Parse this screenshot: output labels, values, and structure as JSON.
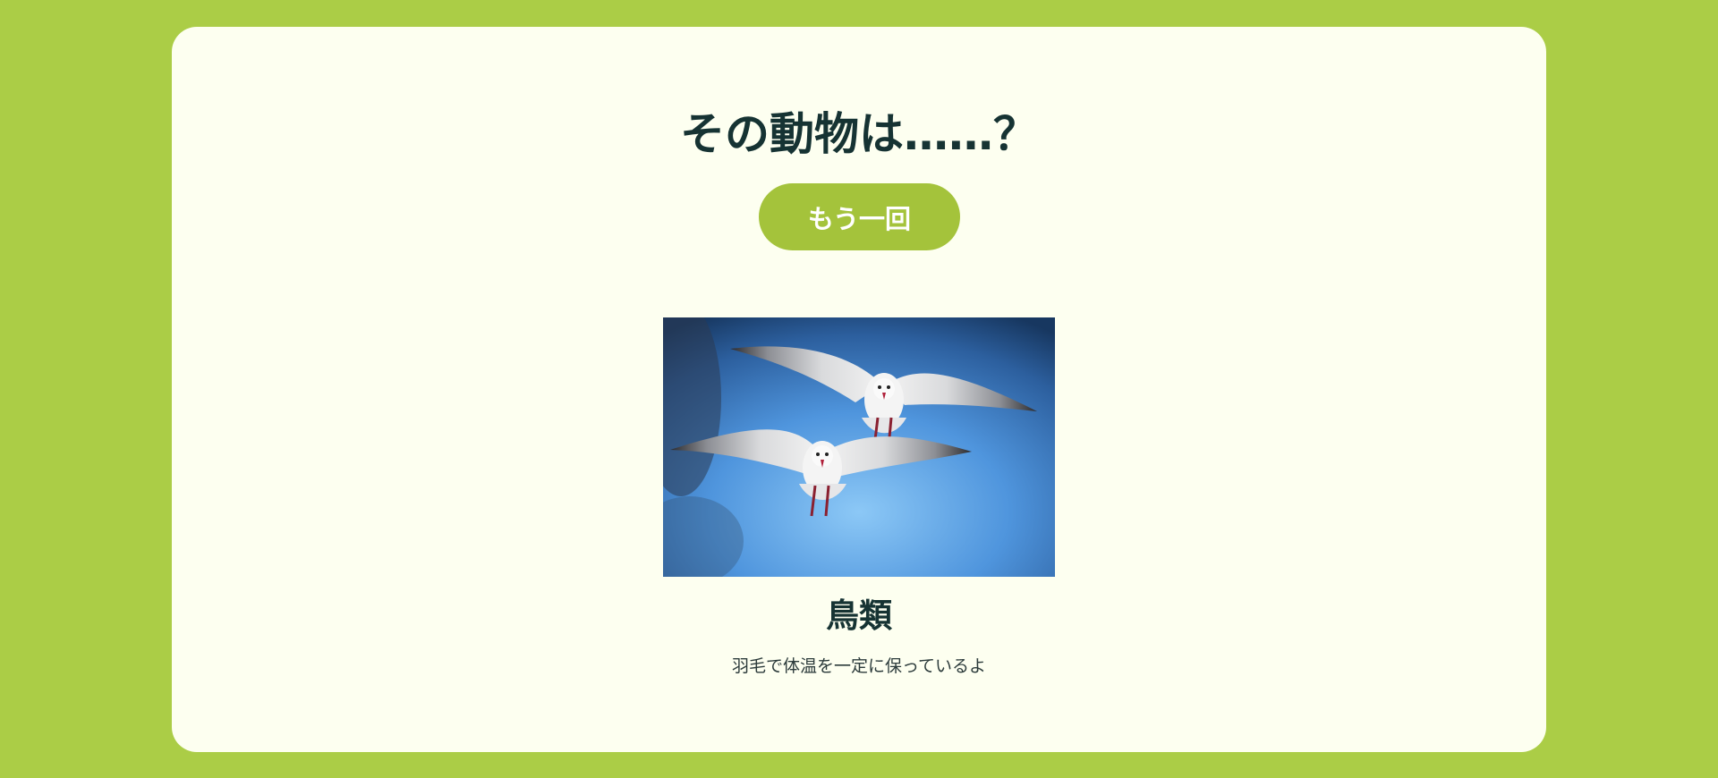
{
  "page": {
    "background_color": "#abcd46",
    "card_color": "#fdfff0",
    "accent_color": "#a4c33b",
    "text_color": "#163333"
  },
  "quiz": {
    "title": "その動物は……？",
    "retry_button_label": "もう一回"
  },
  "result": {
    "image_subject": "two-seagulls-flying-photo",
    "animal_name": "鳥類",
    "description": "羽毛で体温を一定に保っているよ"
  }
}
